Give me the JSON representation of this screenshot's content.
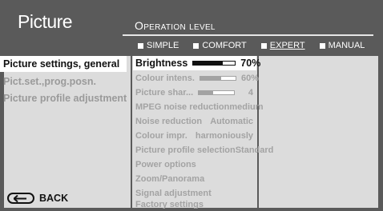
{
  "header": {
    "title": "Picture"
  },
  "operation_level": {
    "title": "Operation level",
    "levels": [
      {
        "label": "SIMPLE",
        "selected": false
      },
      {
        "label": "COMFORT",
        "selected": false
      },
      {
        "label": "EXPERT",
        "selected": true
      },
      {
        "label": "MANUAL",
        "selected": false
      }
    ]
  },
  "left_menu": {
    "items": [
      {
        "label": "Picture settings, general",
        "active": true
      },
      {
        "label": "Pict.set.,prog.posn.",
        "active": false
      },
      {
        "label": "Picture profile adjustment",
        "active": false
      }
    ],
    "back_label": "BACK"
  },
  "settings": {
    "items": [
      {
        "label": "Brightness",
        "value": "70%",
        "level": 0.7,
        "active": true
      },
      {
        "label": "Colour intens.",
        "value": "60%",
        "level": 0.6,
        "active": false
      },
      {
        "label": "Picture shar...",
        "value": "4",
        "level": 0.4,
        "active": false
      },
      {
        "label": "MPEG noise reduction",
        "value": "medium",
        "active": false
      },
      {
        "label": "Noise reduction",
        "value": "Automatic",
        "active": false
      },
      {
        "label": "Colour impr.",
        "value": "harmoniously",
        "active": false
      },
      {
        "label": "Picture profile selection",
        "value": "Standard",
        "active": false
      },
      {
        "label": "Power options",
        "value": "",
        "active": false
      },
      {
        "label": "Zoom/Panorama",
        "value": "",
        "active": false
      },
      {
        "label": "Signal adjustment",
        "value": "",
        "active": false
      },
      {
        "label": "Factory settings",
        "value": "",
        "active": false
      }
    ]
  },
  "colors": {
    "background": "#5a5a5a",
    "panel": "#dcdcdc",
    "highlight": "#ffffff",
    "inactive_text": "#a3a3a3",
    "text": "#111111"
  }
}
